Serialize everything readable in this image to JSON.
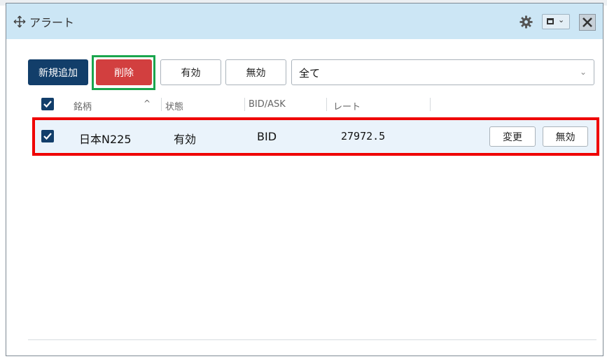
{
  "window": {
    "title": "アラート",
    "icons": {
      "move": "move-icon",
      "settings": "gear-icon",
      "layout": "window-layout-icon",
      "close": "close-icon"
    }
  },
  "toolbar": {
    "new_label": "新規追加",
    "delete_label": "削除",
    "enable_label": "有効",
    "disable_label": "無効",
    "filter_value": "全て"
  },
  "table": {
    "columns": [
      "銘柄",
      "状態",
      "BID/ASK",
      "レート"
    ],
    "sort_indicator": "^",
    "rows": [
      {
        "selected": true,
        "symbol": "日本N225",
        "status": "有効",
        "side": "BID",
        "rate": "27972.5",
        "change_label": "変更",
        "disable_label": "無効"
      }
    ]
  },
  "colors": {
    "titlebar": "#cce6f5",
    "primary": "#123e6a",
    "danger": "#d23f3f",
    "highlight_green": "#1aa54d",
    "highlight_red": "#ef0000",
    "row_bg": "#eaf3fb"
  }
}
